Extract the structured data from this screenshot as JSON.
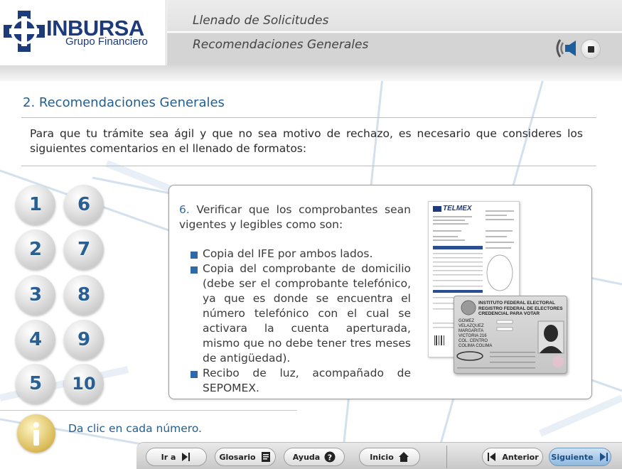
{
  "header": {
    "logo_name": "INBURSA",
    "logo_sub": "Grupo Financiero",
    "title": "Llenado de Solicitudes",
    "subtitle": "Recomendaciones Generales",
    "audio_icon": "speaker-icon",
    "stop_icon": "stop-icon"
  },
  "main": {
    "section_title": "2. Recomendaciones Generales",
    "intro": "Para que tu trámite sea ágil y que no sea motivo de rechazo, es necesario que consideres los siguientes comentarios en el llenado de formatos:",
    "number_buttons": [
      "1",
      "2",
      "3",
      "4",
      "5",
      "6",
      "7",
      "8",
      "9",
      "10"
    ]
  },
  "panel": {
    "number": "6.",
    "heading": "Verificar que los comprobantes sean vigentes y legibles como son:",
    "bullets": [
      "Copia del IFE por ambos lados.",
      "Copia del comprobante de domicilio (debe ser el comprobante telefónico, ya que es donde se encuentra el número telefónico con el cual se activara la cuenta aperturada, mismo que no debe tener tres meses de antigüedad).",
      "Recibo de luz, acompañado de SEPOMEX."
    ],
    "bill_brand": "TELMEX",
    "card_title_1": "INSTITUTO FEDERAL ELECTORAL",
    "card_title_2": "REGISTRO FEDERAL DE ELECTORES",
    "card_title_3": "CREDENCIAL PARA VOTAR",
    "card_lines": [
      "GOMEZ",
      "VELAZQUEZ",
      "MARGARITA",
      "VICTORIA 216",
      "COL. CENTRO",
      "COLIMA COLIMA"
    ]
  },
  "hint": {
    "text": "Da clic en cada número.",
    "icon": "info-icon"
  },
  "nav": {
    "ir_a": "Ir a",
    "glosario": "Glosario",
    "ayuda": "Ayuda",
    "inicio": "Inicio",
    "anterior": "Anterior",
    "siguiente": "Siguiente"
  },
  "colors": {
    "brand_blue": "#1d3a7a",
    "title_blue": "#1f5f96",
    "bullet_blue": "#2e6aa8"
  }
}
